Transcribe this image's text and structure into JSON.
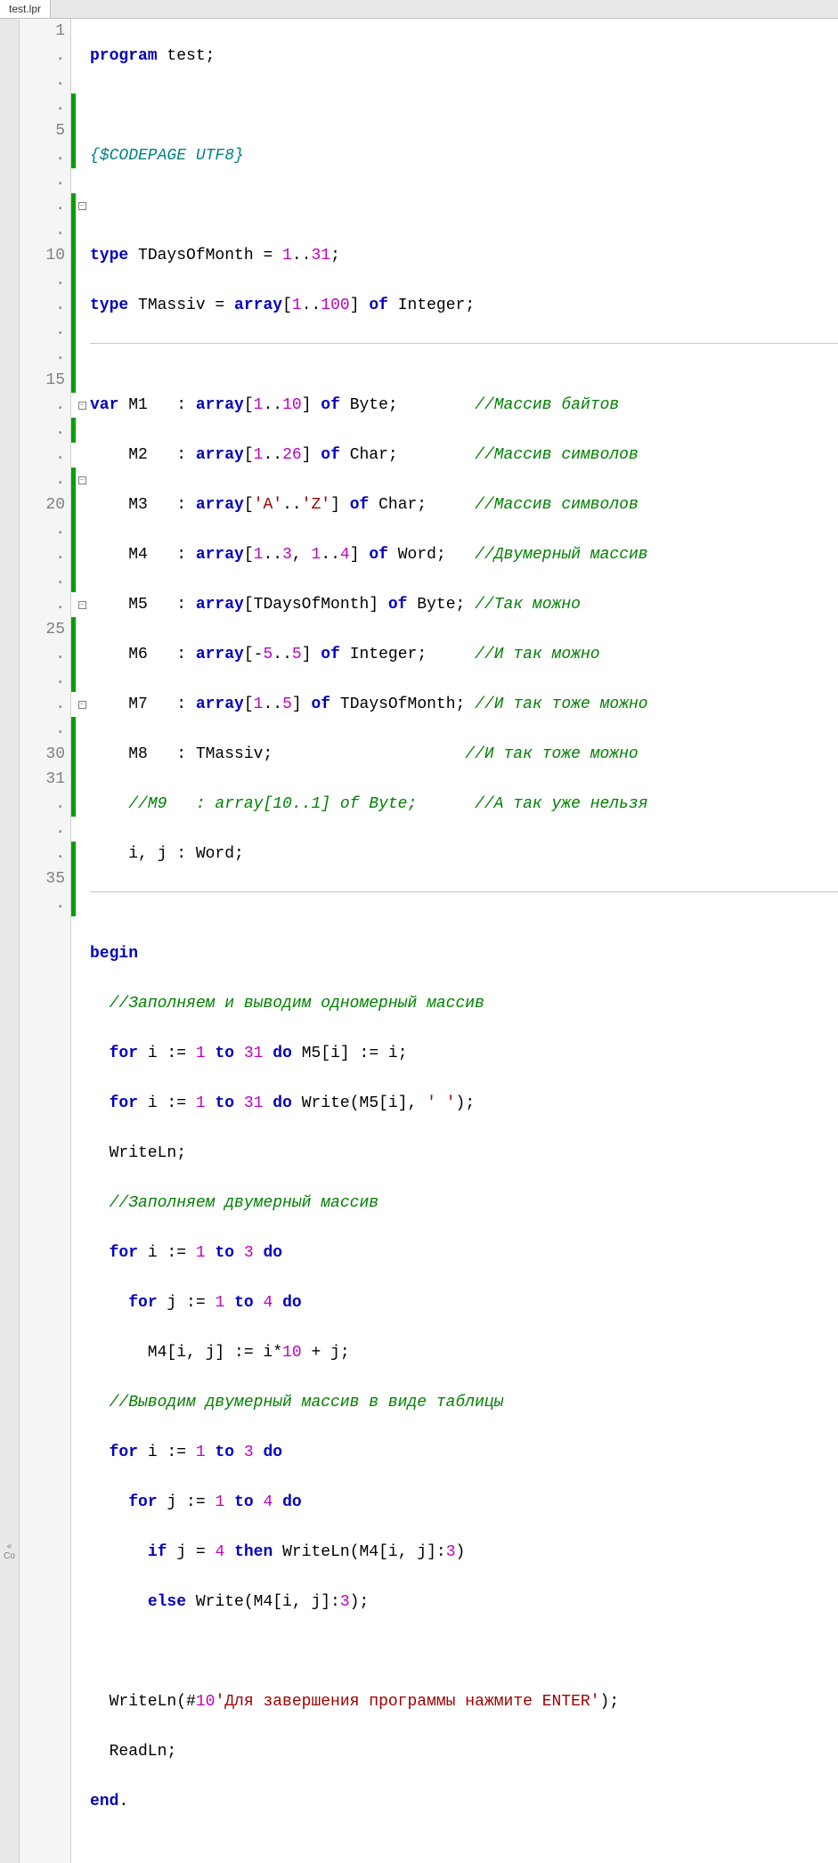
{
  "tab": {
    "filename": "test.lpr"
  },
  "sidebar": {
    "label": "Co"
  },
  "gutter": [
    "1",
    ".",
    ".",
    ".",
    "5",
    ".",
    ".",
    ".",
    ".",
    "10",
    ".",
    ".",
    ".",
    ".",
    "15",
    ".",
    ".",
    ".",
    ".",
    "20",
    ".",
    ".",
    ".",
    ".",
    "25",
    ".",
    ".",
    ".",
    ".",
    "30",
    "31",
    ".",
    ".",
    ".",
    "35",
    "."
  ],
  "changebar": [
    false,
    false,
    false,
    true,
    true,
    true,
    false,
    true,
    true,
    true,
    true,
    true,
    true,
    true,
    true,
    false,
    true,
    false,
    true,
    true,
    true,
    true,
    true,
    false,
    true,
    true,
    true,
    false,
    true,
    true,
    true,
    true,
    false,
    true,
    true,
    true
  ],
  "fold": [
    "",
    "",
    "",
    "",
    "",
    "",
    "",
    "-",
    "",
    "",
    "",
    "",
    "",
    "",
    "",
    "-",
    "",
    "",
    "-",
    "",
    "",
    "",
    "",
    "-",
    "",
    "",
    "",
    "-",
    "",
    "",
    "",
    "",
    "",
    "",
    "",
    ""
  ],
  "code": {
    "l1": {
      "a": "program",
      "b": " test;"
    },
    "l3": "{$CODEPAGE UTF8}",
    "l5": {
      "a": "type",
      "b": " TDaysOfMonth = ",
      "c": "1",
      "d": "..",
      "e": "31",
      "f": ";"
    },
    "l6": {
      "a": "type",
      "b": " TMassiv = ",
      "c": "array",
      "d": "[",
      "e": "1",
      "f": "..",
      "g": "100",
      "h": "] ",
      "i": "of",
      "j": " Integer;"
    },
    "l8": {
      "a": "var",
      "b": " M1   : ",
      "c": "array",
      "d": "[",
      "e": "1",
      "f": "..",
      "g": "10",
      "h": "] ",
      "i": "of",
      "j": " Byte;        ",
      "k": "//Массив байтов"
    },
    "l9": {
      "a": "    M2   : ",
      "b": "array",
      "c": "[",
      "d": "1",
      "e": "..",
      "f": "26",
      "g": "] ",
      "h": "of",
      "i": " Char;        ",
      "j": "//Массив символов"
    },
    "l10": {
      "a": "    M3   : ",
      "b": "array",
      "c": "[",
      "d": "'A'",
      "e": "..",
      "f": "'Z'",
      "g": "] ",
      "h": "of",
      "i": " Char;     ",
      "j": "//Массив символов"
    },
    "l11": {
      "a": "    M4   : ",
      "b": "array",
      "c": "[",
      "d": "1",
      "e": "..",
      "f": "3",
      "g": ", ",
      "h": "1",
      "i": "..",
      "j": "4",
      "k": "] ",
      "l": "of",
      "m": " Word;   ",
      "n": "//Двумерный массив"
    },
    "l12": {
      "a": "    M5   : ",
      "b": "array",
      "c": "[TDaysOfMonth] ",
      "d": "of",
      "e": " Byte; ",
      "f": "//Так можно"
    },
    "l13": {
      "a": "    M6   : ",
      "b": "array",
      "c": "[-",
      "d": "5",
      "e": "..",
      "f": "5",
      "g": "] ",
      "h": "of",
      "i": " Integer;     ",
      "j": "//И так можно"
    },
    "l14": {
      "a": "    M7   : ",
      "b": "array",
      "c": "[",
      "d": "1",
      "e": "..",
      "f": "5",
      "g": "] ",
      "h": "of",
      "i": " TDaysOfMonth; ",
      "j": "//И так тоже можно"
    },
    "l15": {
      "a": "    M8   : TMassiv;                    ",
      "b": "//И так тоже можно"
    },
    "l16": {
      "a": "    ",
      "b": "//M9   : array[10..1] of Byte;      //А так уже нельзя"
    },
    "l17": "    i, j : Word;",
    "l19": "begin",
    "l20": {
      "a": "  ",
      "b": "//Заполняем и выводим одномерный массив"
    },
    "l21": {
      "a": "  ",
      "b": "for",
      "c": " i := ",
      "d": "1",
      "e": " ",
      "f": "to",
      "g": " ",
      "h": "31",
      "i": " ",
      "j": "do",
      "k": " M5[i] := i;"
    },
    "l22": {
      "a": "  ",
      "b": "for",
      "c": " i := ",
      "d": "1",
      "e": " ",
      "f": "to",
      "g": " ",
      "h": "31",
      "i": " ",
      "j": "do",
      "k": " Write(M5[i], ",
      "l": "' '",
      "m": ");"
    },
    "l23": "  WriteLn;",
    "l24": {
      "a": "  ",
      "b": "//Заполняем двумерный массив"
    },
    "l25": {
      "a": "  ",
      "b": "for",
      "c": " i := ",
      "d": "1",
      "e": " ",
      "f": "to",
      "g": " ",
      "h": "3",
      "i": " ",
      "j": "do"
    },
    "l26": {
      "a": "    ",
      "b": "for",
      "c": " j := ",
      "d": "1",
      "e": " ",
      "f": "to",
      "g": " ",
      "h": "4",
      "i": " ",
      "j": "do"
    },
    "l27": {
      "a": "      M4[i, j] := i*",
      "b": "10",
      "c": " + j;"
    },
    "l28": {
      "a": "  ",
      "b": "//Выводим двумерный массив в виде таблицы"
    },
    "l29": {
      "a": "  ",
      "b": "for",
      "c": " i := ",
      "d": "1",
      "e": " ",
      "f": "to",
      "g": " ",
      "h": "3",
      "i": " ",
      "j": "do"
    },
    "l30": {
      "a": "    ",
      "b": "for",
      "c": " j := ",
      "d": "1",
      "e": " ",
      "f": "to",
      "g": " ",
      "h": "4",
      "i": " ",
      "j": "do"
    },
    "l31": {
      "a": "      ",
      "b": "if",
      "c": " j = ",
      "d": "4",
      "e": " ",
      "f": "then",
      "g": " WriteLn(M4[i, j]:",
      "h": "3",
      "i": ")"
    },
    "l32": {
      "a": "      ",
      "b": "else",
      "c": " Write(M4[i, j]:",
      "d": "3",
      "e": ");"
    },
    "l34": {
      "a": "  WriteLn(#",
      "b": "10",
      "c": "'Для завершения программы нажмите ENTER'",
      "d": ");"
    },
    "l35": "  ReadLn;",
    "l36": {
      "a": "end",
      "b": "."
    }
  }
}
